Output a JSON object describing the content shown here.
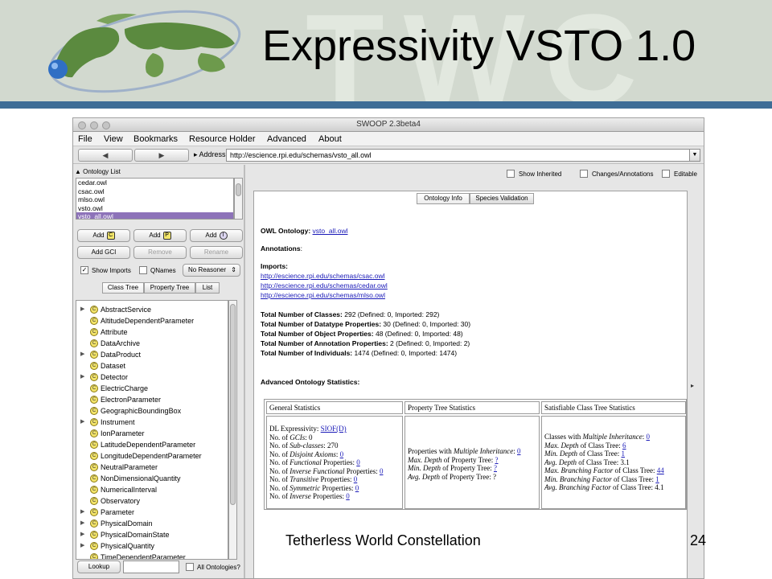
{
  "slide": {
    "title": "Expressivity VSTO 1.0",
    "footer": "Tetherless World Constellation",
    "page_number": "24",
    "watermark": "TWC",
    "colors": {
      "banner": "#d2d9cf",
      "stripe": "#3e6d96",
      "selection": "#8d73b9",
      "link": "#1a1ab8"
    }
  },
  "window": {
    "title": "SWOOP 2.3beta4",
    "menu": [
      "File",
      "View",
      "Bookmarks",
      "Resource Holder",
      "Advanced",
      "About"
    ],
    "nav": {
      "back_icon": "left-arrow-icon",
      "forward_icon": "right-arrow-icon",
      "address_label": "Address:",
      "address": "http://escience.rpi.edu/schemas/vsto_all.owl"
    }
  },
  "left": {
    "ontology_list_label": "Ontology List",
    "ontologies": [
      "cedar.owl",
      "csac.owl",
      "mlso.owl",
      "vsto.owl",
      "vsto_all.owl"
    ],
    "selected_ontology": "vsto_all.owl",
    "buttons": {
      "add_c": "Add",
      "add_c_tag": "C",
      "add_p": "Add",
      "add_p_tag": "P",
      "add_i": "Add",
      "add_i_tag": "I",
      "add_gci": "Add GCI",
      "remove": "Remove",
      "rename": "Rename",
      "lookup": "Lookup"
    },
    "show_imports": {
      "label": "Show Imports",
      "checked": true
    },
    "qnames": {
      "label": "QNames",
      "checked": false
    },
    "reasoner": "No Reasoner",
    "tabs": [
      "Class Tree",
      "Property Tree",
      "List"
    ],
    "active_tab": "Class Tree",
    "tree": [
      {
        "label": "AbstractService",
        "expandable": true
      },
      {
        "label": "AltitudeDependentParameter",
        "expandable": false
      },
      {
        "label": "Attribute",
        "expandable": false
      },
      {
        "label": "DataArchive",
        "expandable": false
      },
      {
        "label": "DataProduct",
        "expandable": true
      },
      {
        "label": "Dataset",
        "expandable": false
      },
      {
        "label": "Detector",
        "expandable": true
      },
      {
        "label": "ElectricCharge",
        "expandable": false
      },
      {
        "label": "ElectronParameter",
        "expandable": false
      },
      {
        "label": "GeographicBoundingBox",
        "expandable": false
      },
      {
        "label": "Instrument",
        "expandable": true
      },
      {
        "label": "IonParameter",
        "expandable": false
      },
      {
        "label": "LatitudeDependentParameter",
        "expandable": false
      },
      {
        "label": "LongitudeDependentParameter",
        "expandable": false
      },
      {
        "label": "NeutralParameter",
        "expandable": false
      },
      {
        "label": "NonDimensionalQuantity",
        "expandable": false
      },
      {
        "label": "NumericalInterval",
        "expandable": false
      },
      {
        "label": "Observatory",
        "expandable": false
      },
      {
        "label": "Parameter",
        "expandable": true
      },
      {
        "label": "PhysicalDomain",
        "expandable": true
      },
      {
        "label": "PhysicalDomainState",
        "expandable": true
      },
      {
        "label": "PhysicalQuantity",
        "expandable": true
      },
      {
        "label": "TimeDependentParameter",
        "expandable": false
      }
    ],
    "all_ontologies": {
      "label": "All Ontologies?",
      "checked": false
    }
  },
  "right": {
    "toolbar": {
      "show_inherited": {
        "label": "Show Inherited",
        "checked": false
      },
      "changes": {
        "label": "Changes/Annotations",
        "checked": false
      },
      "editable": {
        "label": "Editable",
        "checked": false
      }
    },
    "tabs": [
      "Ontology Info",
      "Species Validation"
    ],
    "active_tab": "Ontology Info",
    "info": {
      "ontology_label": "OWL Ontology:",
      "ontology_link": "vsto_all.owl",
      "annotations_label": "Annotations",
      "imports_label": "Imports:",
      "imports": [
        "http://escience.rpi.edu/schemas/csac.owl",
        "http://escience.rpi.edu/schemas/cedar.owl",
        "http://escience.rpi.edu/schemas/mlso.owl"
      ],
      "totals": [
        {
          "label": "Total Number of Classes:",
          "value": "292 (Defined: 0, Imported: 292)"
        },
        {
          "label": "Total Number of Datatype Properties:",
          "value": "30 (Defined: 0, Imported: 30)"
        },
        {
          "label": "Total Number of Object Properties:",
          "value": "48 (Defined: 0, Imported: 48)"
        },
        {
          "label": "Total Number of Annotation Properties:",
          "value": "2 (Defined: 0, Imported: 2)"
        },
        {
          "label": "Total Number of Individuals:",
          "value": "1474 (Defined: 0, Imported: 1474)"
        }
      ],
      "advanced_label": "Advanced Ontology Statistics:"
    },
    "stats": {
      "headers": [
        "General Statistics",
        "Property Tree Statistics",
        "Satisfiable Class Tree Statistics"
      ],
      "general": {
        "dl_label": "DL Expressivity:",
        "dl_value": "SIOF(D)",
        "rows": [
          {
            "pre": "No. of ",
            "it": "GCIs",
            "post": ": ",
            "val": "0",
            "link": false
          },
          {
            "pre": "No. of ",
            "it": "Sub-classes",
            "post": ": ",
            "val": "270",
            "link": false
          },
          {
            "pre": "No. of ",
            "it": "Disjoint Axioms",
            "post": ": ",
            "val": "0",
            "link": true
          },
          {
            "pre": "No. of ",
            "it": "Functional",
            "post": " Properties: ",
            "val": "0",
            "link": true
          },
          {
            "pre": "No. of ",
            "it": "Inverse Functional",
            "post": " Properties: ",
            "val": "0",
            "link": true
          },
          {
            "pre": "No. of ",
            "it": "Transitive",
            "post": " Properties: ",
            "val": "0",
            "link": true
          },
          {
            "pre": "No. of ",
            "it": "Symmetric",
            "post": " Properties: ",
            "val": "0",
            "link": true
          },
          {
            "pre": "No. of ",
            "it": "Inverse",
            "post": " Properties: ",
            "val": "0",
            "link": true
          }
        ]
      },
      "property": [
        {
          "pre": "Properties with ",
          "it": "Multiple Inheritance",
          "post": ": ",
          "val": "0",
          "link": true
        },
        {
          "pre": "",
          "it": "Max. Depth",
          "post": " of Property Tree: ",
          "val": "?",
          "link": true
        },
        {
          "pre": "",
          "it": "Min. Depth",
          "post": " of Property Tree: ",
          "val": "?",
          "link": true
        },
        {
          "pre": "",
          "it": "Avg. Depth",
          "post": " of Property Tree: ",
          "val": "?",
          "link": false
        }
      ],
      "class": [
        {
          "pre": "Classes with ",
          "it": "Multiple Inheritance",
          "post": ": ",
          "val": "0",
          "link": true
        },
        {
          "pre": "",
          "it": "Max. Depth",
          "post": " of Class Tree: ",
          "val": "6",
          "link": true
        },
        {
          "pre": "",
          "it": "Min. Depth",
          "post": " of Class Tree: ",
          "val": "1",
          "link": true
        },
        {
          "pre": "",
          "it": "Avg. Depth",
          "post": " of Class Tree: ",
          "val": "3.1",
          "link": false
        },
        {
          "pre": "",
          "it": "Max. Branching Factor",
          "post": " of Class Tree: ",
          "val": "44",
          "link": true
        },
        {
          "pre": "",
          "it": "Min. Branching Factor",
          "post": " of Class Tree: ",
          "val": "1",
          "link": true
        },
        {
          "pre": "",
          "it": "Avg. Branching Factor",
          "post": " of Class Tree: ",
          "val": "4.1",
          "link": false
        }
      ]
    }
  }
}
